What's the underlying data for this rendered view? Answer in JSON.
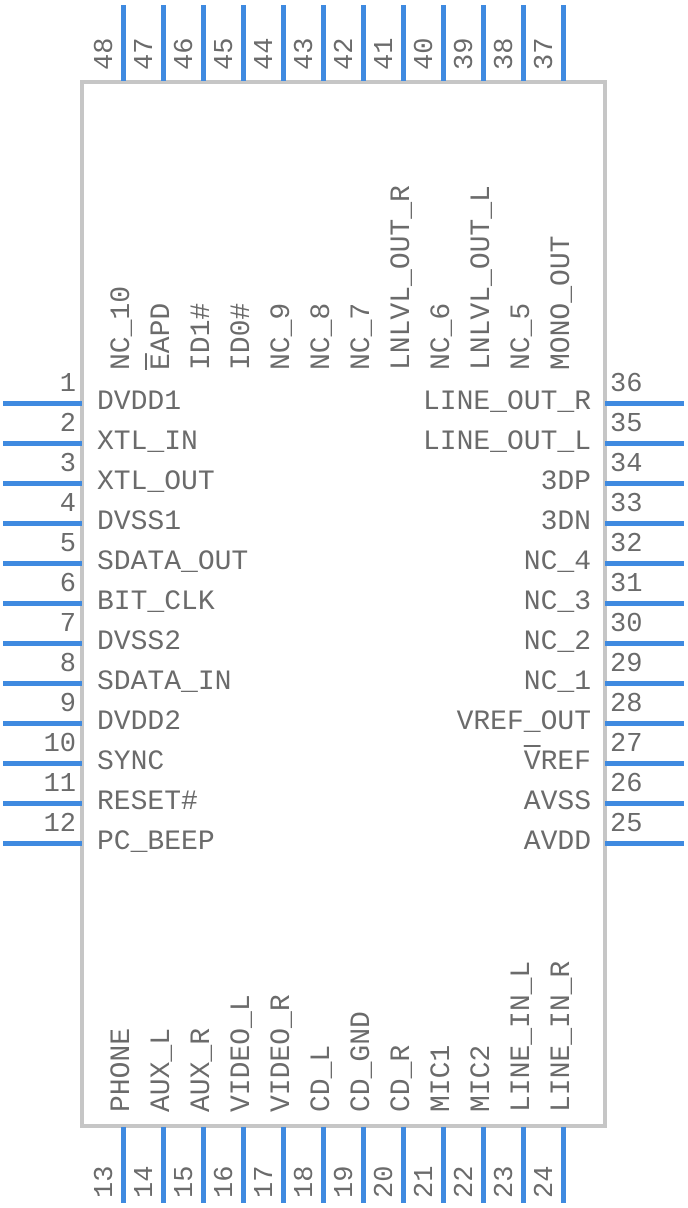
{
  "symbol": {
    "package_pin_count": 48,
    "colors": {
      "lead": "#3f8ae0",
      "body_border": "#c6c6c6",
      "text": "#6b6b6b",
      "background": "#ffffff"
    },
    "left_pins": [
      {
        "number": "1",
        "name": "DVDD1"
      },
      {
        "number": "2",
        "name": "XTL_IN"
      },
      {
        "number": "3",
        "name": "XTL_OUT"
      },
      {
        "number": "4",
        "name": "DVSS1"
      },
      {
        "number": "5",
        "name": "SDATA_OUT"
      },
      {
        "number": "6",
        "name": "BIT_CLK"
      },
      {
        "number": "7",
        "name": "DVSS2"
      },
      {
        "number": "8",
        "name": "SDATA_IN"
      },
      {
        "number": "9",
        "name": "DVDD2"
      },
      {
        "number": "10",
        "name": "SYNC"
      },
      {
        "number": "11",
        "name": "RESET#"
      },
      {
        "number": "12",
        "name": "PC_BEEP"
      }
    ],
    "bottom_pins": [
      {
        "number": "13",
        "name": "PHONE"
      },
      {
        "number": "14",
        "name": "AUX_L"
      },
      {
        "number": "15",
        "name": "AUX_R"
      },
      {
        "number": "16",
        "name": "VIDEO_L"
      },
      {
        "number": "17",
        "name": "VIDEO_R"
      },
      {
        "number": "18",
        "name": "CD_L"
      },
      {
        "number": "19",
        "name": "CD_GND"
      },
      {
        "number": "20",
        "name": "CD_R"
      },
      {
        "number": "21",
        "name": "MIC1"
      },
      {
        "number": "22",
        "name": "MIC2"
      },
      {
        "number": "23",
        "name": "LINE_IN_L"
      },
      {
        "number": "24",
        "name": "LINE_IN_R"
      }
    ],
    "right_pins": [
      {
        "number": "25",
        "name": "AVDD"
      },
      {
        "number": "26",
        "name": "AVSS"
      },
      {
        "number": "27",
        "name": "VREF",
        "overline": true
      },
      {
        "number": "28",
        "name": "VREF_OUT"
      },
      {
        "number": "29",
        "name": "NC_1"
      },
      {
        "number": "30",
        "name": "NC_2"
      },
      {
        "number": "31",
        "name": "NC_3"
      },
      {
        "number": "32",
        "name": "NC_4"
      },
      {
        "number": "33",
        "name": "3DN"
      },
      {
        "number": "34",
        "name": "3DP"
      },
      {
        "number": "35",
        "name": "LINE_OUT_L"
      },
      {
        "number": "36",
        "name": "LINE_OUT_R"
      }
    ],
    "top_pins": [
      {
        "number": "37",
        "name": "MONO_OUT"
      },
      {
        "number": "38",
        "name": "NC_5"
      },
      {
        "number": "39",
        "name": "LNLVL_OUT_L"
      },
      {
        "number": "40",
        "name": "NC_6"
      },
      {
        "number": "41",
        "name": "LNLVL_OUT_R"
      },
      {
        "number": "42",
        "name": "NC_7"
      },
      {
        "number": "43",
        "name": "NC_8"
      },
      {
        "number": "44",
        "name": "NC_9"
      },
      {
        "number": "45",
        "name": "ID0#"
      },
      {
        "number": "46",
        "name": "ID1#"
      },
      {
        "number": "47",
        "name": "EAPD",
        "overline": true
      },
      {
        "number": "48",
        "name": "NC_10"
      }
    ]
  }
}
